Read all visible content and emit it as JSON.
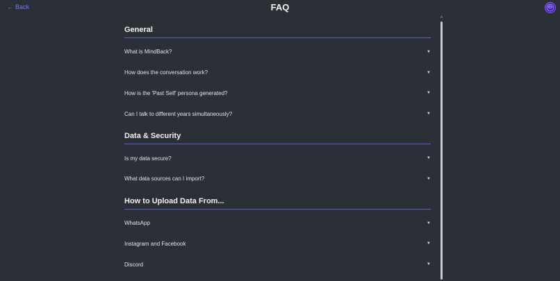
{
  "header": {
    "back_label": "Back",
    "back_arrow": "←",
    "title": "FAQ"
  },
  "sections": [
    {
      "title": "General",
      "items": [
        "What is MindBack?",
        "How does the conversation work?",
        "How is the 'Past Self' persona generated?",
        "Can I talk to different years simultaneously?"
      ]
    },
    {
      "title": "Data & Security",
      "items": [
        "Is my data secure?",
        "What data sources can I import?"
      ]
    },
    {
      "title": "How to Upload Data From...",
      "items": [
        "WhatsApp",
        "Instagram and Facebook",
        "Discord"
      ]
    }
  ],
  "icons": {
    "expand": "▼",
    "scroll_up": "˄"
  },
  "colors": {
    "background": "#2b2f36",
    "accent": "#6f7bf7",
    "divider": "#5a5fe0"
  }
}
